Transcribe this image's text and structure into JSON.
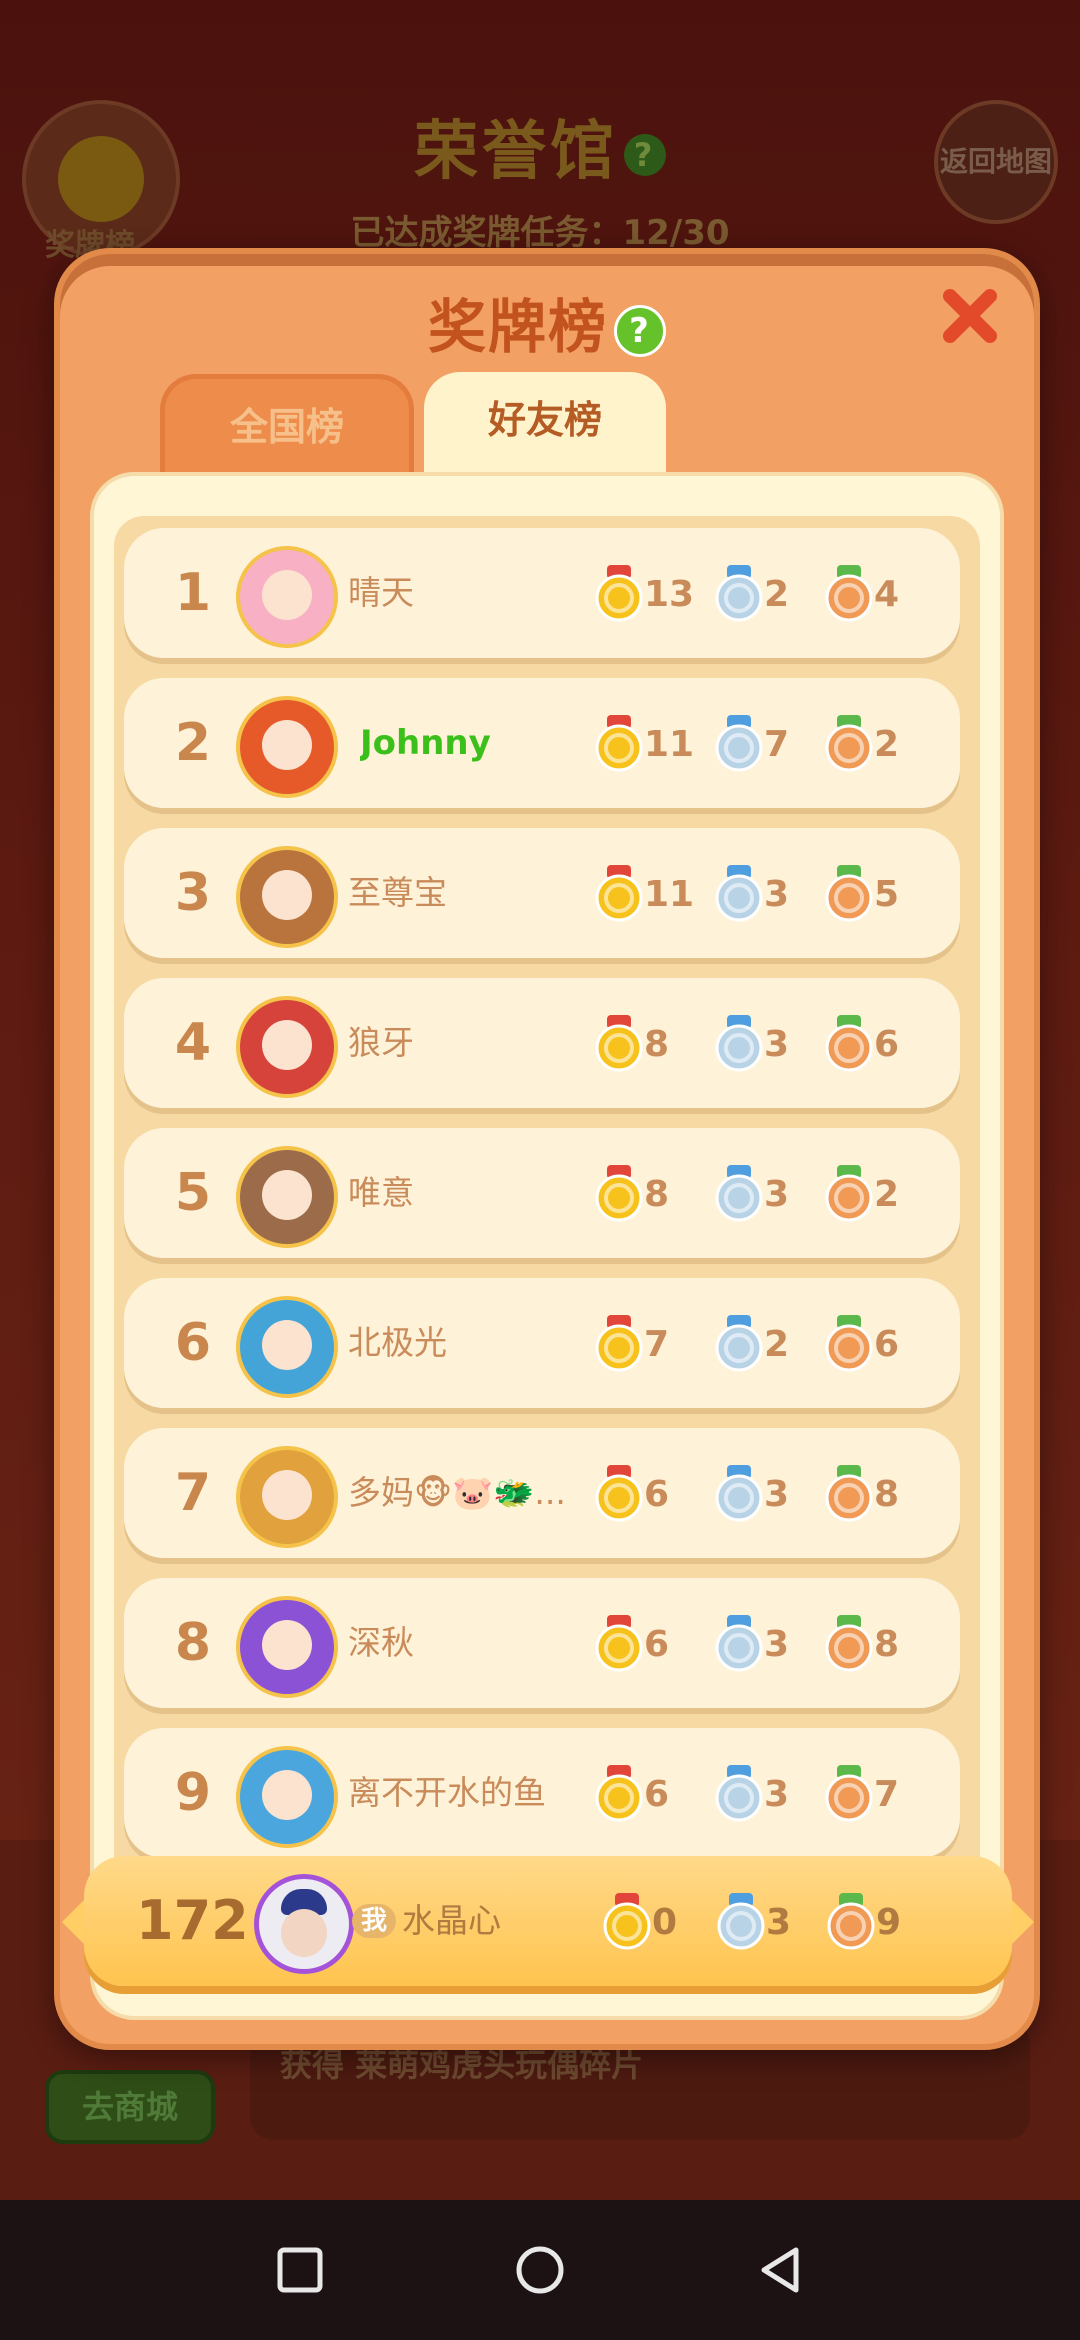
{
  "background": {
    "title": "荣誉馆",
    "title_help": "?",
    "progress_label": "已达成奖牌任务：",
    "progress_value": "12/30",
    "badge_button_label": "奖牌榜",
    "return_label": "返回地图",
    "shop_label": "去商城",
    "reward_text": "获得 莱萌鸡虎头玩偶碎片"
  },
  "dialog": {
    "title": "奖牌榜",
    "help": "?",
    "tabs": [
      {
        "label": "全国榜",
        "selected": false
      },
      {
        "label": "好友榜",
        "selected": true
      }
    ]
  },
  "colors": {
    "gold": "#f7c21c",
    "silver": "#b9d3e6",
    "bronze": "#f09a55",
    "gold_ribbon": "#e2453a",
    "silver_ribbon": "#4f9fe0",
    "bronze_ribbon": "#5bb84a"
  },
  "rows": [
    {
      "rank": "1",
      "name": "晴天",
      "gold": "13",
      "silver": "2",
      "bronze": "4",
      "avatar": "#f7b0c4"
    },
    {
      "rank": "2",
      "name": "Johnny",
      "gold": "11",
      "silver": "7",
      "bronze": "2",
      "avatar": "#e65a2a"
    },
    {
      "rank": "3",
      "name": "至尊宝",
      "gold": "11",
      "silver": "3",
      "bronze": "5",
      "avatar": "#b9733d"
    },
    {
      "rank": "4",
      "name": "狼牙",
      "gold": "8",
      "silver": "3",
      "bronze": "6",
      "avatar": "#d6433a"
    },
    {
      "rank": "5",
      "name": "唯意",
      "gold": "8",
      "silver": "3",
      "bronze": "2",
      "avatar": "#9b6b4a"
    },
    {
      "rank": "6",
      "name": "北极光",
      "gold": "7",
      "silver": "2",
      "bronze": "6",
      "avatar": "#44a4d8"
    },
    {
      "rank": "7",
      "name": "多妈🐵🐷🐲...",
      "gold": "6",
      "silver": "3",
      "bronze": "8",
      "avatar": "#e1a23e"
    },
    {
      "rank": "8",
      "name": "深秋",
      "gold": "6",
      "silver": "3",
      "bronze": "8",
      "avatar": "#8c52d6"
    },
    {
      "rank": "9",
      "name": "离不开水的鱼",
      "gold": "6",
      "silver": "3",
      "bronze": "7",
      "avatar": "#4ba6de"
    }
  ],
  "me": {
    "rank": "172",
    "badge": "我",
    "name": "水晶心",
    "gold": "0",
    "silver": "3",
    "bronze": "9"
  }
}
